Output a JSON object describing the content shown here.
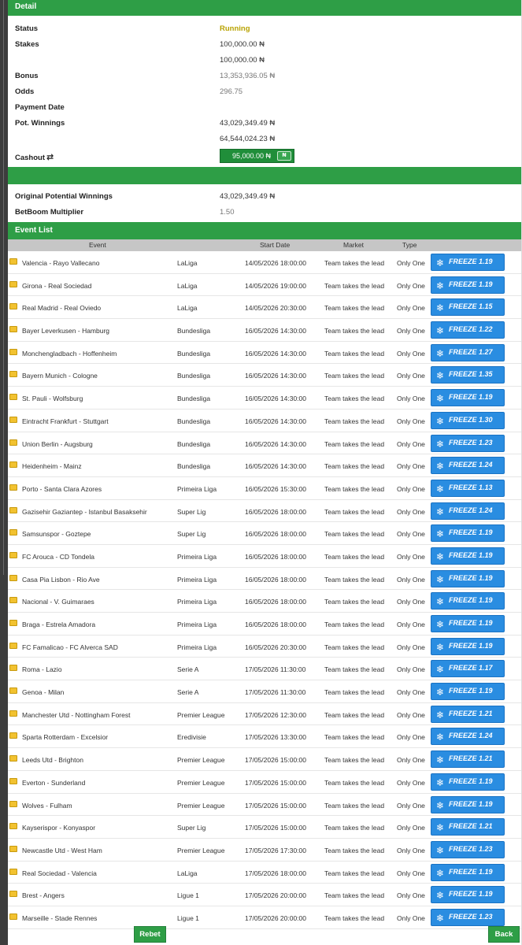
{
  "detail": {
    "title": "Detail",
    "status": {
      "label": "Status",
      "value": "Running"
    },
    "stakes": {
      "label": "Stakes",
      "value1": "100,000.00 ₦",
      "value2": "100,000.00 ₦"
    },
    "bonus": {
      "label": "Bonus",
      "value": "13,353,936.05 ₦"
    },
    "odds": {
      "label": "Odds",
      "value": "296.75"
    },
    "payment_date": {
      "label": "Payment Date",
      "value": ""
    },
    "pot_winnings": {
      "label": "Pot. Winnings",
      "value1": "43,029,349.49 ₦",
      "value2": "64,544,024.23 ₦"
    },
    "cashout": {
      "label": "Cashout",
      "amount": "95,000.00 ₦",
      "icon_text": "₦"
    },
    "original_potential": {
      "label": "Original Potential Winnings",
      "value": "43,029,349.49 ₦"
    },
    "multiplier": {
      "label": "BetBoom Multiplier",
      "value": "1.50"
    }
  },
  "event_list": {
    "title": "Event List",
    "columns": {
      "event": "Event",
      "start_date": "Start Date",
      "market": "Market",
      "type": "Type"
    },
    "rows": [
      {
        "event": "Valencia - Rayo Vallecano",
        "league": "LaLiga",
        "date": "14/05/2026 18:00:00",
        "market": "Team takes the lead",
        "type": "Only One",
        "freeze": "FREEZE 1.19"
      },
      {
        "event": "Girona - Real Sociedad",
        "league": "LaLiga",
        "date": "14/05/2026 19:00:00",
        "market": "Team takes the lead",
        "type": "Only One",
        "freeze": "FREEZE 1.19"
      },
      {
        "event": "Real Madrid - Real Oviedo",
        "league": "LaLiga",
        "date": "14/05/2026 20:30:00",
        "market": "Team takes the lead",
        "type": "Only One",
        "freeze": "FREEZE 1.15"
      },
      {
        "event": "Bayer Leverkusen - Hamburg",
        "league": "Bundesliga",
        "date": "16/05/2026 14:30:00",
        "market": "Team takes the lead",
        "type": "Only One",
        "freeze": "FREEZE 1.22"
      },
      {
        "event": "Monchengladbach - Hoffenheim",
        "league": "Bundesliga",
        "date": "16/05/2026 14:30:00",
        "market": "Team takes the lead",
        "type": "Only One",
        "freeze": "FREEZE 1.27"
      },
      {
        "event": "Bayern Munich - Cologne",
        "league": "Bundesliga",
        "date": "16/05/2026 14:30:00",
        "market": "Team takes the lead",
        "type": "Only One",
        "freeze": "FREEZE 1.35"
      },
      {
        "event": "St. Pauli - Wolfsburg",
        "league": "Bundesliga",
        "date": "16/05/2026 14:30:00",
        "market": "Team takes the lead",
        "type": "Only One",
        "freeze": "FREEZE 1.19"
      },
      {
        "event": "Eintracht Frankfurt - Stuttgart",
        "league": "Bundesliga",
        "date": "16/05/2026 14:30:00",
        "market": "Team takes the lead",
        "type": "Only One",
        "freeze": "FREEZE 1.30"
      },
      {
        "event": "Union Berlin - Augsburg",
        "league": "Bundesliga",
        "date": "16/05/2026 14:30:00",
        "market": "Team takes the lead",
        "type": "Only One",
        "freeze": "FREEZE 1.23"
      },
      {
        "event": "Heidenheim - Mainz",
        "league": "Bundesliga",
        "date": "16/05/2026 14:30:00",
        "market": "Team takes the lead",
        "type": "Only One",
        "freeze": "FREEZE 1.24"
      },
      {
        "event": "Porto - Santa Clara Azores",
        "league": "Primeira Liga",
        "date": "16/05/2026 15:30:00",
        "market": "Team takes the lead",
        "type": "Only One",
        "freeze": "FREEZE 1.13"
      },
      {
        "event": "Gazisehir Gaziantep - Istanbul Basaksehir",
        "league": "Super Lig",
        "date": "16/05/2026 18:00:00",
        "market": "Team takes the lead",
        "type": "Only One",
        "freeze": "FREEZE 1.24"
      },
      {
        "event": "Samsunspor - Goztepe",
        "league": "Super Lig",
        "date": "16/05/2026 18:00:00",
        "market": "Team takes the lead",
        "type": "Only One",
        "freeze": "FREEZE 1.19"
      },
      {
        "event": "FC Arouca - CD Tondela",
        "league": "Primeira Liga",
        "date": "16/05/2026 18:00:00",
        "market": "Team takes the lead",
        "type": "Only One",
        "freeze": "FREEZE 1.19"
      },
      {
        "event": "Casa Pia Lisbon - Rio Ave",
        "league": "Primeira Liga",
        "date": "16/05/2026 18:00:00",
        "market": "Team takes the lead",
        "type": "Only One",
        "freeze": "FREEZE 1.19"
      },
      {
        "event": "Nacional - V. Guimaraes",
        "league": "Primeira Liga",
        "date": "16/05/2026 18:00:00",
        "market": "Team takes the lead",
        "type": "Only One",
        "freeze": "FREEZE 1.19"
      },
      {
        "event": "Braga - Estrela Amadora",
        "league": "Primeira Liga",
        "date": "16/05/2026 18:00:00",
        "market": "Team takes the lead",
        "type": "Only One",
        "freeze": "FREEZE 1.19"
      },
      {
        "event": "FC Famalicao - FC Alverca SAD",
        "league": "Primeira Liga",
        "date": "16/05/2026 20:30:00",
        "market": "Team takes the lead",
        "type": "Only One",
        "freeze": "FREEZE 1.19"
      },
      {
        "event": "Roma - Lazio",
        "league": "Serie A",
        "date": "17/05/2026 11:30:00",
        "market": "Team takes the lead",
        "type": "Only One",
        "freeze": "FREEZE 1.17"
      },
      {
        "event": "Genoa - Milan",
        "league": "Serie A",
        "date": "17/05/2026 11:30:00",
        "market": "Team takes the lead",
        "type": "Only One",
        "freeze": "FREEZE 1.19"
      },
      {
        "event": "Manchester Utd - Nottingham Forest",
        "league": "Premier League",
        "date": "17/05/2026 12:30:00",
        "market": "Team takes the lead",
        "type": "Only One",
        "freeze": "FREEZE 1.21"
      },
      {
        "event": "Sparta Rotterdam - Excelsior",
        "league": "Eredivisie",
        "date": "17/05/2026 13:30:00",
        "market": "Team takes the lead",
        "type": "Only One",
        "freeze": "FREEZE 1.24"
      },
      {
        "event": "Leeds Utd - Brighton",
        "league": "Premier League",
        "date": "17/05/2026 15:00:00",
        "market": "Team takes the lead",
        "type": "Only One",
        "freeze": "FREEZE 1.21"
      },
      {
        "event": "Everton - Sunderland",
        "league": "Premier League",
        "date": "17/05/2026 15:00:00",
        "market": "Team takes the lead",
        "type": "Only One",
        "freeze": "FREEZE 1.19"
      },
      {
        "event": "Wolves - Fulham",
        "league": "Premier League",
        "date": "17/05/2026 15:00:00",
        "market": "Team takes the lead",
        "type": "Only One",
        "freeze": "FREEZE 1.19"
      },
      {
        "event": "Kayserispor - Konyaspor",
        "league": "Super Lig",
        "date": "17/05/2026 15:00:00",
        "market": "Team takes the lead",
        "type": "Only One",
        "freeze": "FREEZE 1.21"
      },
      {
        "event": "Newcastle Utd - West Ham",
        "league": "Premier League",
        "date": "17/05/2026 17:30:00",
        "market": "Team takes the lead",
        "type": "Only One",
        "freeze": "FREEZE 1.23"
      },
      {
        "event": "Real Sociedad - Valencia",
        "league": "LaLiga",
        "date": "17/05/2026 18:00:00",
        "market": "Team takes the lead",
        "type": "Only One",
        "freeze": "FREEZE 1.19"
      },
      {
        "event": "Brest - Angers",
        "league": "Ligue 1",
        "date": "17/05/2026 20:00:00",
        "market": "Team takes the lead",
        "type": "Only One",
        "freeze": "FREEZE 1.19"
      },
      {
        "event": "Marseille - Stade Rennes",
        "league": "Ligue 1",
        "date": "17/05/2026 20:00:00",
        "market": "Team takes the lead",
        "type": "Only One",
        "freeze": "FREEZE 1.23"
      }
    ]
  },
  "footer": {
    "rebet_label": "Rebet",
    "back_label": "Back"
  },
  "colors": {
    "green": "#2e9e46",
    "blue": "#2a8de1",
    "status_running": "#b8a200"
  }
}
